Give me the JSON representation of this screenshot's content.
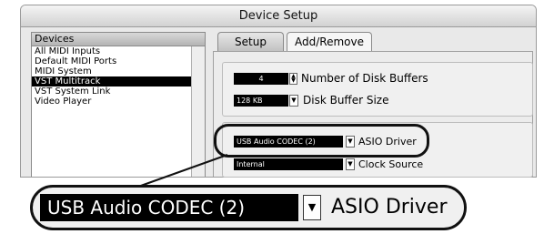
{
  "window": {
    "title": "Device Setup"
  },
  "sidebar": {
    "header": "Devices",
    "items": [
      {
        "label": "All MIDI Inputs",
        "selected": false
      },
      {
        "label": "Default MIDI Ports",
        "selected": false
      },
      {
        "label": "MIDI System",
        "selected": false
      },
      {
        "label": "VST Multitrack",
        "selected": true
      },
      {
        "label": "VST System Link",
        "selected": false
      },
      {
        "label": "Video Player",
        "selected": false
      }
    ]
  },
  "tabs": [
    {
      "label": "Setup",
      "active": true
    },
    {
      "label": "Add/Remove",
      "active": false
    }
  ],
  "disk": {
    "buffers_value": "4",
    "buffers_label": "Number of Disk Buffers",
    "size_value": "128 KB",
    "size_label": "Disk Buffer Size"
  },
  "asio": {
    "driver_value": "USB Audio CODEC  (2)",
    "driver_label": "ASIO Driver",
    "clock_value": "Internal",
    "clock_label": "Clock Source"
  },
  "zoom": {
    "driver_value": "USB Audio CODEC  (2)",
    "driver_label": "ASIO Driver"
  },
  "icons": {
    "stepper": "up-down-stepper-icon",
    "dropdown": "chevron-down-icon"
  }
}
